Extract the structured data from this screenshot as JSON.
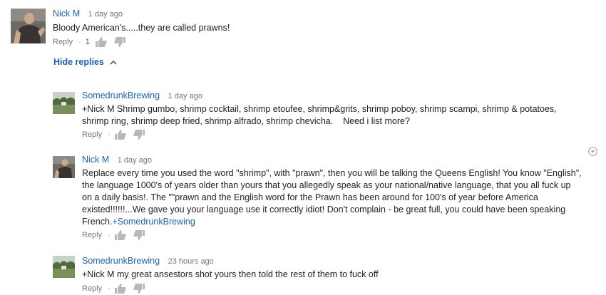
{
  "comments": [
    {
      "author": "Nick M",
      "time": "1 day ago",
      "text": "Bloody American's.....they are called prawns!",
      "reply_label": "Reply",
      "like_count": "1"
    }
  ],
  "hide_replies_label": "Hide replies",
  "replies": [
    {
      "author": "SomedrunkBrewing",
      "time": "1 day ago",
      "lines": [
        "+Nick M Shrimp gumbo, shrimp cocktail, shrimp etoufee, shrimp&grits, shrimp poboy, shrimp scampi, shrimp & potatoes,",
        "shrimp ring, shrimp deep fried, shrimp alfrado, shrimp chevicha.    Need i list more?"
      ],
      "reply_label": "Reply"
    },
    {
      "author": "Nick M",
      "time": "1 day ago",
      "lines": [
        "Replace every time you used the word \"shrimp\", with \"prawn\", then you will be talking the Queens English! You know \"English\",",
        "the language 1000's of years older than yours that you allegedly speak as your national/native  language, that you all fuck up",
        "on a daily basis!. The \"\"prawn and the English word for the Prawn has been around for 100's of year before America",
        "existed!!!!!!...We gave you your language use it correctly idiot! Don't complain - be great full, you could have been speaking"
      ],
      "last_line_text": "French.",
      "last_line_mention": "+SomedrunkBrewing",
      "reply_label": "Reply"
    },
    {
      "author": "SomedrunkBrewing",
      "time": "23 hours ago",
      "lines": [
        "+Nick M my great ansestors shot yours then told the rest of them to fuck off"
      ],
      "reply_label": "Reply"
    }
  ],
  "icons": {
    "like": "thumbs-up-icon",
    "dislike": "thumbs-down-icon",
    "chevron": "chevron-up-icon",
    "menu": "dropdown-menu-icon"
  },
  "colors": {
    "link": "#1c62b9",
    "meta": "#767676",
    "icon": "#b8b8b8"
  }
}
